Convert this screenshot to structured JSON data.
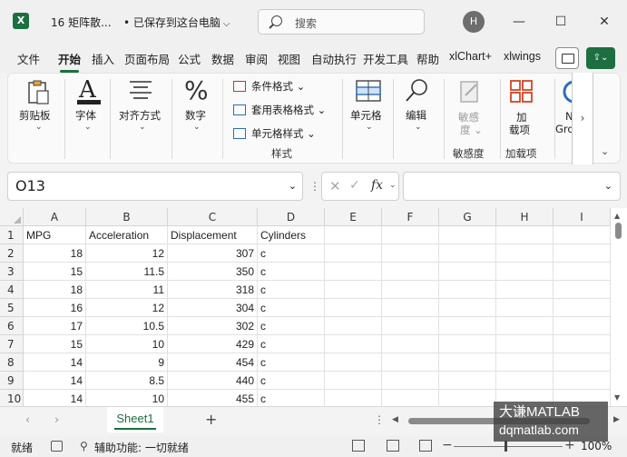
{
  "titlebar": {
    "doc_name": "16 矩阵散...",
    "separator": "•",
    "saved_status": "已保存到这台电脑",
    "search_placeholder": "搜索",
    "avatar_initial": "H",
    "minimize": "—",
    "maximize": "☐",
    "close": "✕"
  },
  "tabs": [
    "文件",
    "开始",
    "插入",
    "页面布局",
    "公式",
    "数据",
    "审阅",
    "视图",
    "自动执行",
    "开发工具",
    "帮助",
    "xlChart+",
    "xlwings"
  ],
  "active_tab": "开始",
  "ribbon": {
    "clipboard": "剪贴板",
    "font": "字体",
    "alignment": "对齐方式",
    "number": "数字",
    "conditional_format": "条件格式",
    "format_as_table": "套用表格格式",
    "cell_styles": "单元格样式",
    "styles_group": "样式",
    "cells": "单元格",
    "editing": "编辑",
    "sensitivity_l1": "敏感",
    "sensitivity_l2": "度",
    "sensitivity_group": "敏感度",
    "addins_l1": "加",
    "addins_l2": "载项",
    "addins_group": "加载项",
    "partial_l1": "N",
    "partial_l2": "Gro",
    "scroll_right": "›",
    "collapse": "⌄"
  },
  "formula_bar": {
    "name_box": "O13",
    "dots": "⋮",
    "cancel": "✕",
    "enter": "✓",
    "fx": "fx",
    "formula": ""
  },
  "grid": {
    "columns": [
      "A",
      "B",
      "C",
      "D",
      "E",
      "F",
      "G",
      "H",
      "I"
    ],
    "row_numbers": [
      "1",
      "2",
      "3",
      "4",
      "5",
      "6",
      "7",
      "8",
      "9",
      "10"
    ],
    "header_row": [
      "MPG",
      "Acceleration",
      "Displacement",
      "Cylinders"
    ],
    "rows": [
      [
        "18",
        "12",
        "307",
        "c"
      ],
      [
        "15",
        "11.5",
        "350",
        "c"
      ],
      [
        "18",
        "11",
        "318",
        "c"
      ],
      [
        "16",
        "12",
        "304",
        "c"
      ],
      [
        "17",
        "10.5",
        "302",
        "c"
      ],
      [
        "15",
        "10",
        "429",
        "c"
      ],
      [
        "14",
        "9",
        "454",
        "c"
      ],
      [
        "14",
        "8.5",
        "440",
        "c"
      ],
      [
        "14",
        "10",
        "455",
        "c"
      ]
    ]
  },
  "sheetbar": {
    "prev": "‹",
    "next": "›",
    "sheet_name": "Sheet1",
    "add": "+",
    "dots": "⋮"
  },
  "watermark": {
    "line1": "大谦MATLAB",
    "line2": "dqmatlab.com"
  },
  "statusbar": {
    "ready": "就绪",
    "accessibility": "辅助功能: 一切就绪",
    "zoom": "100%"
  }
}
